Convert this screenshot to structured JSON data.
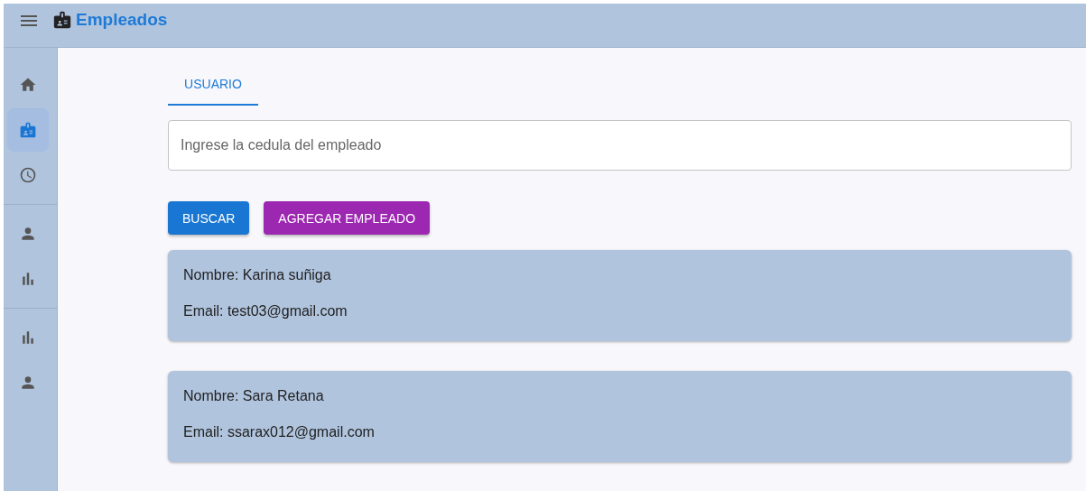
{
  "app_bar": {
    "title": "Empleados"
  },
  "sidebar": {
    "sections": [
      {
        "items": [
          {
            "selected": false
          },
          {
            "selected": true
          },
          {
            "selected": false
          }
        ]
      },
      {
        "items": [
          {
            "selected": false
          },
          {
            "selected": false
          }
        ]
      },
      {
        "items": [
          {
            "selected": false
          },
          {
            "selected": false
          }
        ]
      }
    ]
  },
  "tabs": [
    {
      "label": "USUARIO",
      "selected": true
    }
  ],
  "search": {
    "placeholder": "Ingrese la cedula del empleado"
  },
  "buttons": [
    {
      "label": "BUSCAR",
      "kind": "primary"
    },
    {
      "label": "AGREGAR EMPLEADO",
      "kind": "secondary"
    }
  ],
  "employees": [
    {
      "name": "Nombre: Karina suñiga",
      "email": "Email: test03@gmail.com"
    },
    {
      "name": "Nombre: Sara Retana",
      "email": "Email: ssarax012@gmail.com"
    }
  ]
}
